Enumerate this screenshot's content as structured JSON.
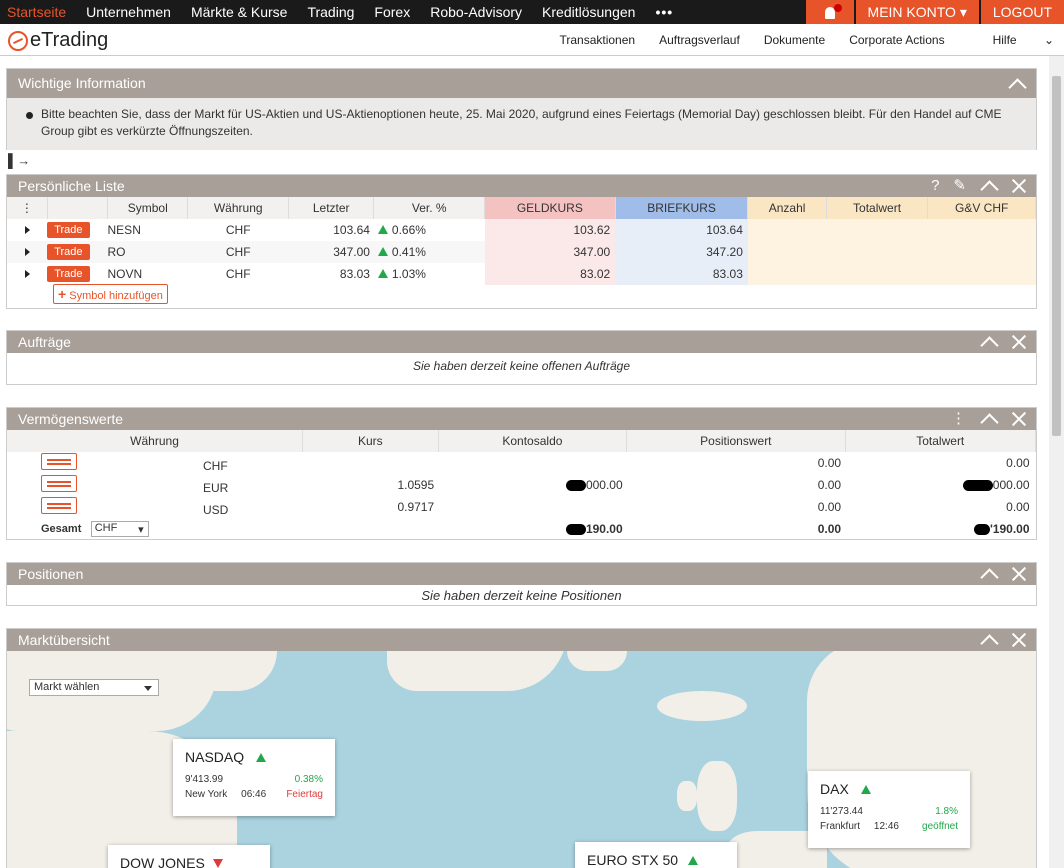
{
  "topnav": {
    "items": [
      "Startseite",
      "Unternehmen",
      "Märkte & Kurse",
      "Trading",
      "Forex",
      "Robo-Advisory",
      "Kreditlösungen"
    ],
    "more": "•••",
    "account": "MEIN KONTO",
    "logout": "LOGOUT"
  },
  "brand": {
    "name": "eTrading"
  },
  "subnav": {
    "items": [
      "Transaktionen",
      "Auftragsverlauf",
      "Dokumente",
      "Corporate Actions",
      "Hilfe"
    ]
  },
  "info": {
    "title": "Wichtige Information",
    "text": "Bitte beachten Sie, dass der Markt für US-Aktien und US-Aktienoptionen heute, 25. Mai 2020, aufgrund eines Feiertags (Memorial Day) geschlossen bleibt. Für den Handel auf CME Group gibt es verkürzte Öffnungszeiten."
  },
  "watchlist": {
    "title": "Persönliche Liste",
    "headers": [
      "Symbol",
      "Währung",
      "Letzter",
      "Ver. %",
      "GELDKURS",
      "BRIEFKURS",
      "Anzahl",
      "Totalwert",
      "G&V CHF"
    ],
    "trade_label": "Trade",
    "rows": [
      {
        "symbol": "NESN",
        "currency": "CHF",
        "last": "103.64",
        "change": "0.66%",
        "bid": "103.62",
        "ask": "103.64"
      },
      {
        "symbol": "RO",
        "currency": "CHF",
        "last": "347.00",
        "change": "0.41%",
        "bid": "347.00",
        "ask": "347.20"
      },
      {
        "symbol": "NOVN",
        "currency": "CHF",
        "last": "83.03",
        "change": "1.03%",
        "bid": "83.02",
        "ask": "83.03"
      }
    ],
    "add_label": "Symbol hinzufügen",
    "help": "?"
  },
  "orders": {
    "title": "Aufträge",
    "empty": "Sie haben derzeit keine offenen Aufträge"
  },
  "assets": {
    "title": "Vermögenswerte",
    "headers": [
      "Währung",
      "Kurs",
      "Kontosaldo",
      "Positionswert",
      "Totalwert"
    ],
    "rows": [
      {
        "currency": "CHF",
        "rate": "",
        "balance": "",
        "position": "0.00",
        "total": "0.00"
      },
      {
        "currency": "EUR",
        "rate": "1.0595",
        "balance": "000.00",
        "position": "0.00",
        "total": "000.00"
      },
      {
        "currency": "USD",
        "rate": "0.9717",
        "balance": "",
        "position": "0.00",
        "total": "0.00"
      }
    ],
    "total_label": "Gesamt",
    "total_currency": "CHF",
    "total_balance": "190.00",
    "total_position": "0.00",
    "total_total": "'190.00"
  },
  "positions": {
    "title": "Positionen",
    "empty": "Sie haben derzeit keine Positionen"
  },
  "market": {
    "title": "Marktübersicht",
    "select": "Markt wählen",
    "cards": [
      {
        "name": "NASDAQ",
        "value": "9'413.99",
        "change": "0.38%",
        "city": "New York",
        "time": "06:46",
        "status": "Feiertag",
        "dir": "up"
      },
      {
        "name": "DAX",
        "value": "11'273.44",
        "change": "1.8%",
        "city": "Frankfurt",
        "time": "12:46",
        "status": "geöffnet",
        "dir": "up"
      },
      {
        "name": "DOW JONES",
        "dir": "down"
      },
      {
        "name": "EURO STX 50",
        "dir": "up"
      }
    ]
  },
  "colors": {
    "accent": "#e8542a",
    "panel_header": "#a89f98",
    "up": "#22a84a",
    "down": "#e03b3b"
  }
}
